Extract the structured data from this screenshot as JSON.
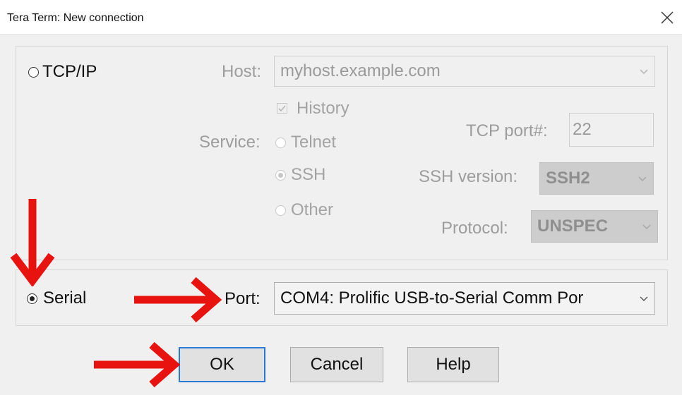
{
  "window": {
    "title": "Tera Term: New connection",
    "close_icon": "close-icon"
  },
  "tcpip": {
    "radio_label": "TCP/IP",
    "selected": false,
    "host_label": "Host:",
    "host_value": "myhost.example.com",
    "history_label": "History",
    "history_checked": true,
    "service_label": "Service:",
    "services": [
      "Telnet",
      "SSH",
      "Other"
    ],
    "service_selected": "SSH",
    "tcp_port_label": "TCP port#:",
    "tcp_port_value": "22",
    "ssh_version_label": "SSH version:",
    "ssh_version_value": "SSH2",
    "protocol_label": "Protocol:",
    "protocol_value": "UNSPEC"
  },
  "serial": {
    "radio_label": "Serial",
    "selected": true,
    "port_label": "Port:",
    "port_value": "COM4: Prolific USB-to-Serial Comm Por"
  },
  "buttons": {
    "ok": "OK",
    "cancel": "Cancel",
    "help": "Help"
  },
  "colors": {
    "annotation_arrow": "#e8130f",
    "default_button_border": "#2b79d7",
    "dialog_background": "#f0f0f0"
  }
}
